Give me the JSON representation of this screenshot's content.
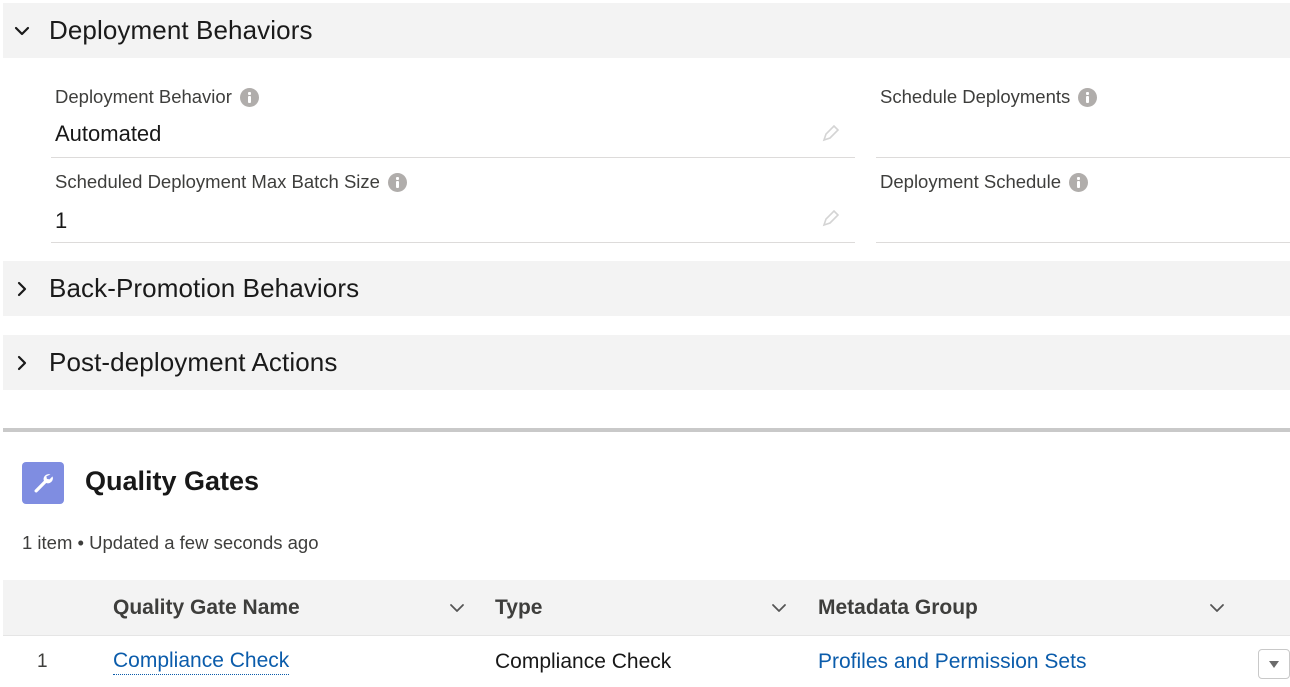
{
  "sections": {
    "deployment": {
      "title": "Deployment Behaviors",
      "expanded": true
    },
    "back_promotion": {
      "title": "Back-Promotion Behaviors",
      "expanded": false
    },
    "post_deployment": {
      "title": "Post-deployment Actions",
      "expanded": false
    }
  },
  "fields": {
    "deployment_behavior": {
      "label": "Deployment Behavior",
      "value": "Automated"
    },
    "schedule_deployments": {
      "label": "Schedule Deployments",
      "value": ""
    },
    "max_batch_size": {
      "label": "Scheduled Deployment Max Batch Size",
      "value": "1"
    },
    "deployment_schedule": {
      "label": "Deployment Schedule",
      "value": ""
    }
  },
  "quality_gates": {
    "title": "Quality Gates",
    "subtitle": "1 item • Updated a few seconds ago",
    "icon": "wrench-icon",
    "icon_color": "#7f8de1",
    "columns": [
      "Quality Gate Name",
      "Type",
      "Metadata Group"
    ],
    "rows": [
      {
        "num": "1",
        "name": "Compliance Check",
        "type": "Compliance Check",
        "metadata_group": "Profiles and Permission Sets"
      }
    ]
  },
  "colors": {
    "link": "#0b5cab",
    "header_bg": "#f3f3f3"
  }
}
